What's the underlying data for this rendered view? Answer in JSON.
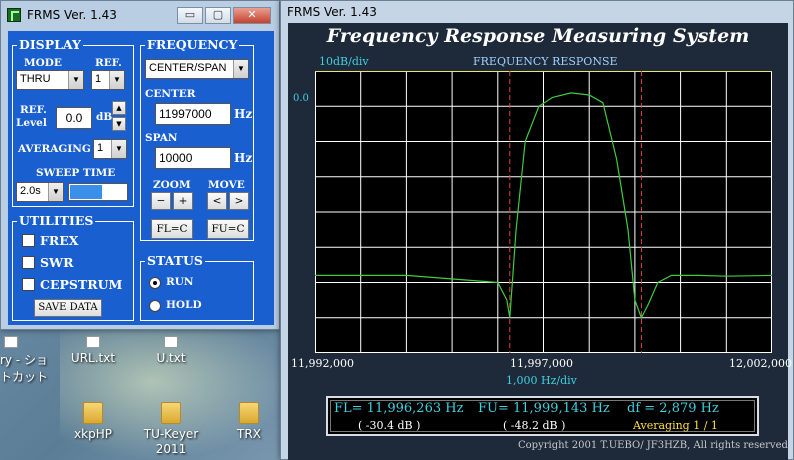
{
  "desktop": {
    "icons": [
      {
        "label": "ry - ショ\nトカット",
        "kind": "doc"
      },
      {
        "label": "URL.txt",
        "kind": "doc"
      },
      {
        "label": "U.txt",
        "kind": "doc"
      },
      {
        "label": "xkpHP",
        "kind": "folder"
      },
      {
        "label": "TU-Keyer\n2011",
        "kind": "folder"
      },
      {
        "label": "TRX",
        "kind": "folder"
      }
    ]
  },
  "control_window": {
    "title": "FRMS  Ver. 1.43",
    "titlebar_buttons": {
      "minimize": "▭",
      "maximize": "▢",
      "close": "✕"
    },
    "display": {
      "title": "DISPLAY",
      "mode_label": "MODE",
      "mode_value": "THRU",
      "ref_label": "REF.",
      "ref_value": "1",
      "ref_level_label": "REF.\nLevel",
      "ref_level_value": "0.0",
      "ref_level_unit": "dB",
      "averaging_label": "AVERAGING",
      "averaging_value": "1",
      "sweep_time_label": "SWEEP TIME",
      "sweep_time_value": "2.0s",
      "sweep_progress": 0.55
    },
    "frequency": {
      "title": "FREQUENCY",
      "mode_value": "CENTER/SPAN",
      "center_label": "CENTER",
      "center_value": "11997000",
      "center_unit": "Hz",
      "span_label": "SPAN",
      "span_value": "10000",
      "span_unit": "Hz",
      "zoom_label": "ZOOM",
      "zoom_out": "−",
      "zoom_in": "+",
      "move_label": "MOVE",
      "move_left": "<",
      "move_right": ">",
      "fl_c": "FL=C",
      "fu_c": "FU=C"
    },
    "utilities": {
      "title": "UTILITIES",
      "frex": "FREX",
      "swr": "SWR",
      "cepstrum": "CEPSTRUM",
      "save_data": "SAVE DATA"
    },
    "status": {
      "title": "STATUS",
      "run": "RUN",
      "hold": "HOLD",
      "selected": "RUN"
    }
  },
  "main_window": {
    "title": "FRMS  Ver. 1.43",
    "heading": "Frequency Response Measuring System",
    "plot": {
      "y_scale": "10dB/div",
      "plot_title": "FREQUENCY RESPONSE",
      "ref_level": "0.0",
      "x_ticks": [
        "11,992,000",
        "11,997,000",
        "12,002,000"
      ],
      "x_scale": "1,000  Hz/div"
    },
    "readout": {
      "fl": "FL= 11,996,263  Hz",
      "fu": "FU= 11,999,143  Hz",
      "df": "df = 2,879  Hz",
      "fl_db": "( -30.4 dB )",
      "fu_db": "( -48.2 dB )",
      "averaging": "Averaging   1 / 1"
    },
    "copyright": "Copyright 2001 T.UEBO/ JF3HZB, All rights reserved."
  },
  "colors": {
    "trace": "#3fcc3f",
    "grid": "#ffffff",
    "marker": "#e04040",
    "label_cyan": "#3fd0e0",
    "panel_blue": "#1a5fd0",
    "plot_bg": "#000000"
  },
  "chart_data": {
    "type": "line",
    "x_axis": {
      "min": 11992000,
      "max": 12002000,
      "unit": "Hz",
      "ticks": [
        11992000,
        11997000,
        12002000
      ]
    },
    "y_axis": {
      "min": -80,
      "max": 0,
      "unit": "dB",
      "division": 10
    },
    "grid": true,
    "markers": {
      "fl": 11996263,
      "fu": 11999143
    },
    "series": [
      {
        "x": [
          11992000,
          11994000,
          11996000,
          11996200,
          11996263,
          11996400,
          11996600,
          11996900,
          11997200,
          11997600,
          11998000,
          11998300,
          11998600,
          11998850,
          11999000,
          11999143,
          11999300,
          11999500,
          11999800,
          12000400,
          12001000,
          12002000
        ],
        "y": [
          -58.0,
          -58.0,
          -60.0,
          -65.0,
          -70.0,
          -45.0,
          -20.0,
          -10.0,
          -7.5,
          -6.2,
          -6.8,
          -9.0,
          -25.0,
          -45.0,
          -65.0,
          -70.0,
          -66.0,
          -60.0,
          -58.0,
          -58.0,
          -58.2,
          -58.0
        ]
      }
    ]
  }
}
